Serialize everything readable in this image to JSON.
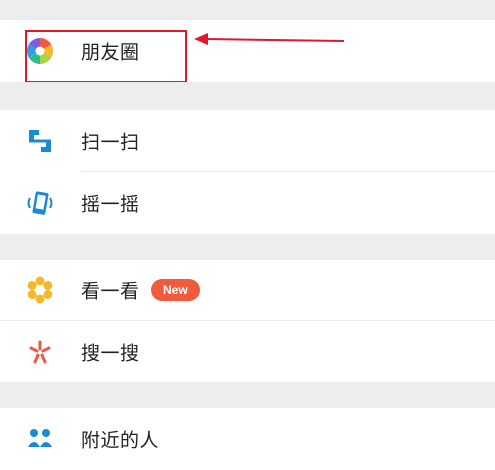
{
  "menu": {
    "moments": {
      "label": "朋友圈",
      "icon": "moments-aperture-icon"
    },
    "scan": {
      "label": "扫一扫",
      "icon": "scan-icon"
    },
    "shake": {
      "label": "摇一摇",
      "icon": "shake-phone-icon"
    },
    "top_stories": {
      "label": "看一看",
      "icon": "top-stories-icon",
      "badge": "New"
    },
    "search": {
      "label": "搜一搜",
      "icon": "search-star-icon"
    },
    "nearby": {
      "label": "附近的人",
      "icon": "people-nearby-icon"
    }
  },
  "colors": {
    "annotation": "#e0182a",
    "badge": "#f25a3c",
    "scan_blue": "#1a8ad4",
    "top_stories_yellow": "#f5b82a",
    "search_red": "#e95a4b"
  }
}
